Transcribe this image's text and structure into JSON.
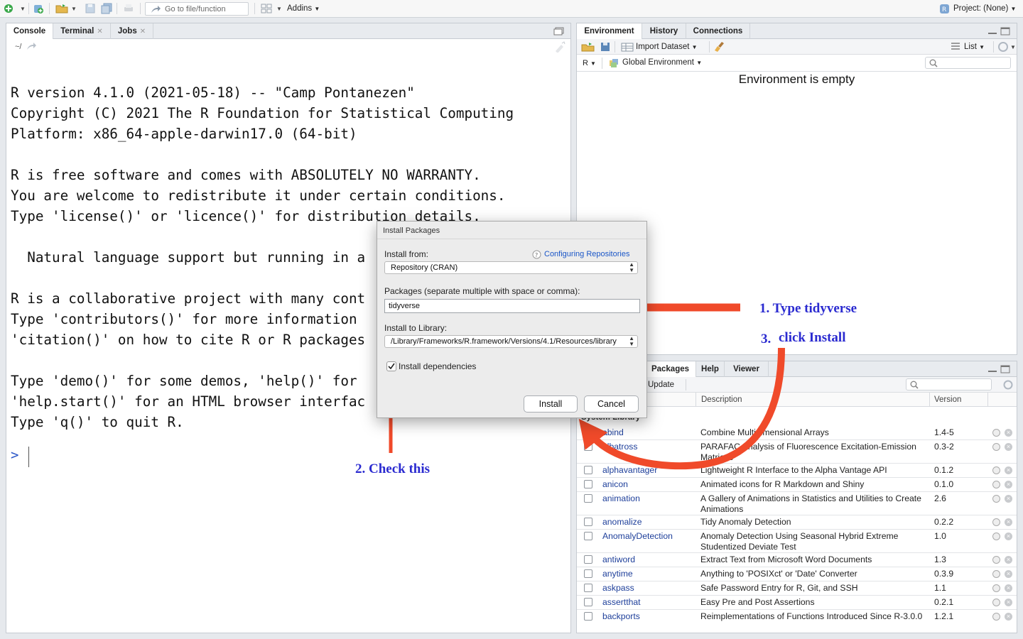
{
  "toolbar": {
    "goto_placeholder": "Go to file/function",
    "addins_label": "Addins",
    "project_label": "Project: (None)"
  },
  "console_pane": {
    "tabs": [
      "Console",
      "Terminal",
      "Jobs"
    ],
    "path": "~/",
    "lines": [
      "",
      "R version 4.1.0 (2021-05-18) -- \"Camp Pontanezen\"",
      "Copyright (C) 2021 The R Foundation for Statistical Computing",
      "Platform: x86_64-apple-darwin17.0 (64-bit)",
      "",
      "R is free software and comes with ABSOLUTELY NO WARRANTY.",
      "You are welcome to redistribute it under certain conditions.",
      "Type 'license()' or 'licence()' for distribution details.",
      "",
      "  Natural language support but running in a",
      "",
      "R is a collaborative project with many cont",
      "Type 'contributors()' for more information",
      "'citation()' on how to cite R or R packages",
      "",
      "Type 'demo()' for some demos, 'help()' for",
      "'help.start()' for an HTML browser interfac",
      "Type 'q()' to quit R.",
      ""
    ],
    "prompt": ">"
  },
  "env_pane": {
    "tabs": [
      "Environment",
      "History",
      "Connections"
    ],
    "import_dataset": "Import Dataset",
    "list_label": "List",
    "lang": "R",
    "scope": "Global Environment",
    "empty_message": "Environment is empty"
  },
  "packages_pane": {
    "tabs": [
      "Packages",
      "Help",
      "Viewer"
    ],
    "update_label": "Update",
    "columns": {
      "description": "Description",
      "version": "Version"
    },
    "section_label": "System Library",
    "rows": [
      {
        "name": "abind",
        "description": "Combine Multidimensional Arrays",
        "version": "1.4-5"
      },
      {
        "name": "albatross",
        "description": "PARAFAC Analysis of Fluorescence Excitation-Emission Matrices",
        "version": "0.3-2"
      },
      {
        "name": "alphavantager",
        "description": "Lightweight R Interface to the Alpha Vantage API",
        "version": "0.1.2"
      },
      {
        "name": "anicon",
        "description": "Animated icons for R Markdown and Shiny",
        "version": "0.1.0"
      },
      {
        "name": "animation",
        "description": "A Gallery of Animations in Statistics and Utilities to Create Animations",
        "version": "2.6"
      },
      {
        "name": "anomalize",
        "description": "Tidy Anomaly Detection",
        "version": "0.2.2"
      },
      {
        "name": "AnomalyDetection",
        "description": "Anomaly Detection Using Seasonal Hybrid Extreme Studentized Deviate Test",
        "version": "1.0"
      },
      {
        "name": "antiword",
        "description": "Extract Text from Microsoft Word Documents",
        "version": "1.3"
      },
      {
        "name": "anytime",
        "description": "Anything to 'POSIXct' or 'Date' Converter",
        "version": "0.3.9"
      },
      {
        "name": "askpass",
        "description": "Safe Password Entry for R, Git, and SSH",
        "version": "1.1"
      },
      {
        "name": "assertthat",
        "description": "Easy Pre and Post Assertions",
        "version": "0.2.1"
      },
      {
        "name": "backports",
        "description": "Reimplementations of Functions Introduced Since R-3.0.0",
        "version": "1.2.1"
      }
    ]
  },
  "dialog": {
    "title": "Install Packages",
    "install_from_label": "Install from:",
    "help_link": "Configuring Repositories",
    "install_from_value": "Repository (CRAN)",
    "packages_label": "Packages (separate multiple with space or comma):",
    "packages_value": "tidyverse",
    "library_label": "Install to Library:",
    "library_value": "/Library/Frameworks/R.framework/Versions/4.1/Resources/library",
    "dependencies_label": "Install dependencies",
    "dependencies_checked": true,
    "install_button": "Install",
    "cancel_button": "Cancel"
  },
  "annotations": {
    "step1": "1. Type tidyverse",
    "step2": "2. Check this",
    "step3_num": "3.",
    "step3_text": "click Install",
    "arrow_color": "#f04a2a"
  }
}
